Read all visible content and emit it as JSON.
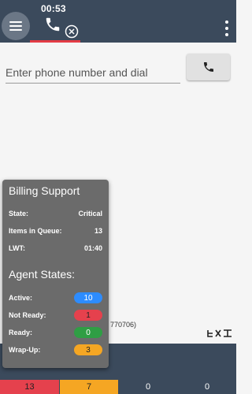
{
  "header": {
    "timer": "00:53",
    "icons": [
      "hamburger-menu-icon",
      "phone-icon",
      "close-circle-icon",
      "more-vert-icon"
    ],
    "accent_color": "#e33b45",
    "bar_color": "#3b4a5c"
  },
  "dialer": {
    "placeholder": "Enter phone number and dial",
    "dial_icon": "phone-icon"
  },
  "background": {
    "partial_text": "770706)"
  },
  "popup": {
    "title": "Billing Support",
    "rows": [
      {
        "label": "State:",
        "value": "Critical"
      },
      {
        "label": "Items in Queue:",
        "value": "13"
      },
      {
        "label": "LWT:",
        "value": "01:40"
      }
    ],
    "agent_title": "Agent States:",
    "agents": [
      {
        "label": "Active:",
        "value": "10",
        "color": "#2d8cff"
      },
      {
        "label": "Not Ready:",
        "value": "1",
        "color": "#e5414d"
      },
      {
        "label": "Ready:",
        "value": "0",
        "color": "#2f9e44"
      },
      {
        "label": "Wrap-Up:",
        "value": "3",
        "color": "#f5a623"
      }
    ]
  },
  "stats": [
    "13",
    "7",
    "0",
    "0"
  ]
}
